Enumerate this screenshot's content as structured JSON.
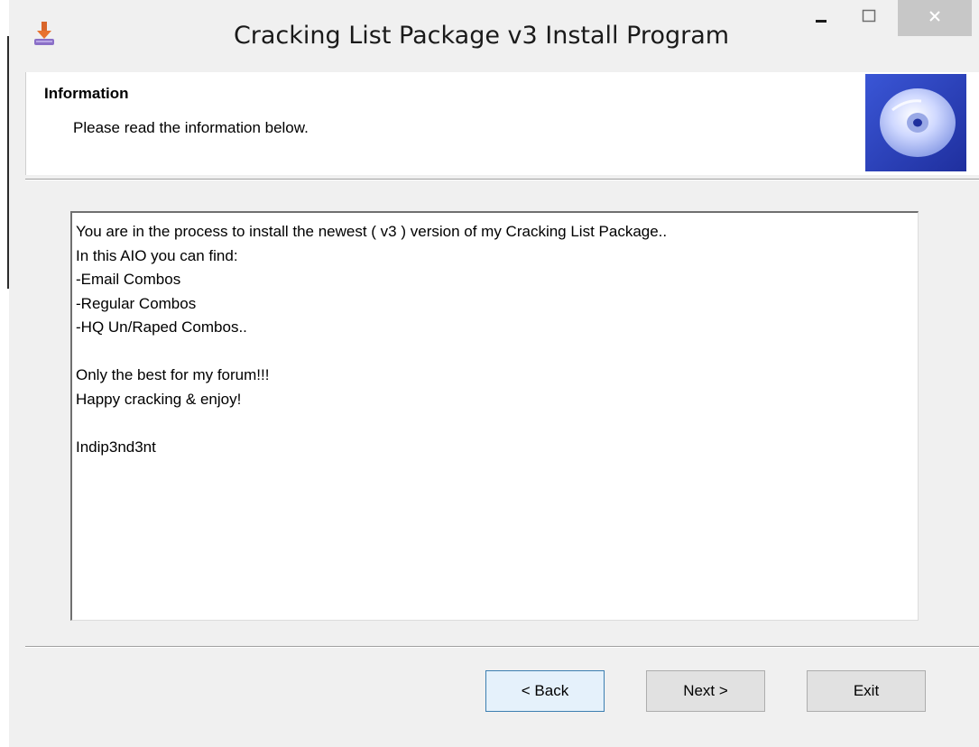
{
  "window": {
    "title": "Cracking List Package v3 Install Program"
  },
  "header": {
    "title": "Information",
    "subtitle": "Please read the information below."
  },
  "info_text": "You are in the process to install the newest ( v3 ) version of my Cracking List Package..\nIn this AIO you can find:\n-Email Combos\n-Regular Combos\n-HQ Un/Raped Combos..\n\nOnly the best for my forum!!!\nHappy cracking & enjoy!\n\nIndip3nd3nt",
  "buttons": {
    "back": "< Back",
    "next": "Next >",
    "exit": "Exit"
  },
  "icons": {
    "app": "installer-icon",
    "header": "cd-disc-icon",
    "minimize": "minimize-icon",
    "maximize": "maximize-icon",
    "close": "close-icon"
  },
  "colors": {
    "close_button": "#c7c7c7",
    "back_button_border": "#3c7fb1"
  }
}
